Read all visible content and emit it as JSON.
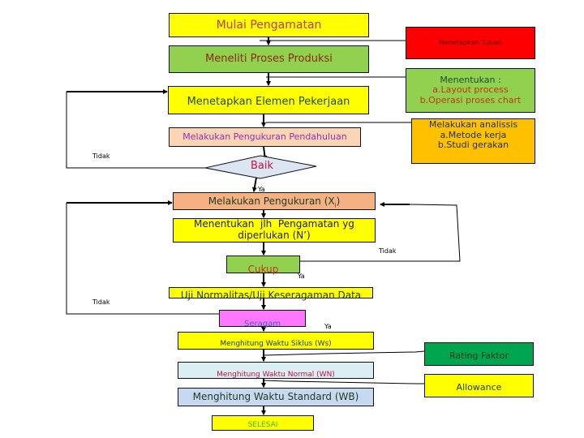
{
  "diagram": {
    "type": "flowchart",
    "nodes": {
      "start": {
        "label": "Mulai Pengamatan",
        "fill": "#ffff00",
        "text_color": "#c0392b"
      },
      "research": {
        "label": "Meneliti Proses Produksi",
        "fill": "#92d050",
        "text_color": "#8b2a0e"
      },
      "set_elements": {
        "label": "Menetapkan Elemen Pekerjaan",
        "fill": "#ffff00",
        "text_color": "#1f4e2c"
      },
      "preliminary": {
        "label": "Melakukan Pengukuran Pendahuluan",
        "fill": "#fbd5b5",
        "text_color": "#9b2fae"
      },
      "decision_good": {
        "label": "Baik",
        "fill": "#dce6f2",
        "text_color": "#c0143c"
      },
      "measure": {
        "label": "Melakukan Pengukuran (X",
        "label_sub": "i",
        "label_end": ")",
        "fill": "#f4b183",
        "text_color": "#1f3b1f"
      },
      "determine_n": {
        "line1": "Menentukan  jlh  Pengamatan yg",
        "line2": "diperlukan (N’)",
        "fill": "#ffff00",
        "text_color": "#1f1f4e"
      },
      "decision_enough": {
        "label": "Cukup",
        "fill": "#92d050",
        "text_color": "#c0390b"
      },
      "normality": {
        "label": "Uji Normalitas/Uji Keseragaman Data",
        "fill": "#ffff00",
        "text_color": "#1f3b1f"
      },
      "decision_uniform": {
        "label": "Seragam",
        "fill": "#ff77ff",
        "text_color": "#4a5bd4"
      },
      "cycle_time": {
        "label": "Menghitung Waktu Siklus (Ws)",
        "fill": "#ffff00",
        "text_color": "#1f3b1f"
      },
      "normal_time": {
        "label": "Menghitung Waktu Normal (WN)",
        "fill": "#dbeef4",
        "text_color": "#c0143c"
      },
      "standard_time": {
        "label": "Menghitung Waktu Standard (WB)",
        "fill": "#c6d9f1",
        "text_color": "#1f3b1f"
      },
      "end": {
        "label": "SELESAI",
        "fill": "#ffff00",
        "text_color": "#4caf1a"
      }
    },
    "side_notes": {
      "goal": {
        "label": "Menetapkan Tujuan",
        "fill": "#ff0000",
        "text_color": "#5a0000"
      },
      "determine": {
        "line1": "Menentukan :",
        "line2": "a.Layout process",
        "line3": "b.Operasi proses chart",
        "fill": "#92d050",
        "title_color": "#1f4e2c",
        "item_color": "#c0390b"
      },
      "analysis": {
        "line1": "Melakukan analissis",
        "line2": "a.Metode kerja",
        "line3": "b.Studi gerakan",
        "fill": "#ffc000",
        "text_color": "#1f2f3f"
      },
      "rating": {
        "label": "Rating Faktor",
        "fill": "#00a550",
        "text_color": "#1f3b1f"
      },
      "allowance": {
        "label": "Allowance",
        "fill": "#ffff00",
        "text_color": "#1f3b1f"
      }
    },
    "edge_labels": {
      "tidak_baik": "Tidak",
      "ya_baik": "Ya",
      "tidak_cukup": "Tidak",
      "ya_cukup": "Ya",
      "tidak_seragam": "Tidak",
      "ya_seragam": "Ya"
    }
  }
}
